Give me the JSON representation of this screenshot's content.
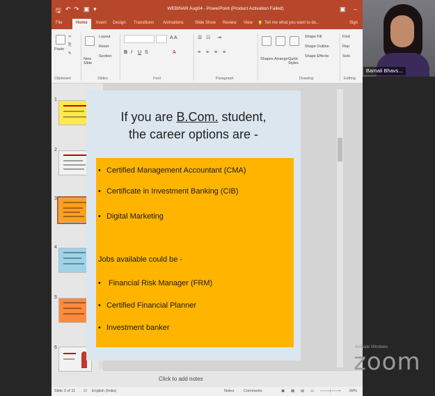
{
  "window": {
    "title": "WEBINAR Aug04 - PowerPoint (Product Activation Failed)"
  },
  "tabs": [
    "File",
    "Home",
    "Insert",
    "Design",
    "Transitions",
    "Animations",
    "Slide Show",
    "Review",
    "View"
  ],
  "tell_me": "Tell me what you want to do...",
  "sign_in": "Sign",
  "ribbon": {
    "paste": "Paste",
    "new_slide": "New Slide",
    "layout": "Layout",
    "reset": "Reset",
    "section": "Section",
    "shapes": "Shapes",
    "arrange": "Arrange",
    "quick_styles": "Quick Styles",
    "shape_fill": "Shape Fill",
    "shape_outline": "Shape Outline",
    "shape_effects": "Shape Effects",
    "find": "Find",
    "replace": "Rep",
    "select": "Sele",
    "groups": {
      "clipboard": "Clipboard",
      "slides": "Slides",
      "font": "Font",
      "paragraph": "Paragraph",
      "drawing": "Drawing",
      "editing": "Editing"
    }
  },
  "thumbnails": [
    {
      "num": "1",
      "color": "#ffe94d"
    },
    {
      "num": "2",
      "color": "#f2f2f2"
    },
    {
      "num": "3",
      "color": "#ff9f1c"
    },
    {
      "num": "4",
      "color": "#9dd3e8"
    },
    {
      "num": "5",
      "color": "#ff8a3d"
    },
    {
      "num": "6",
      "color": "#f2f2f2"
    }
  ],
  "slide": {
    "title_line1_prefix": "If you are ",
    "title_line1_underlined": "B.Com.",
    "title_line1_suffix": " student,",
    "title_line2": "the career options are -",
    "bullets": [
      "Certified Management Accountant (CMA)",
      "Certificate in Investment Banking (CIB)",
      "Digital Marketing"
    ],
    "jobs_heading": "Jobs available could be -",
    "jobs": [
      "Financial Risk Manager (FRM)",
      "Certified Financial Planner",
      "Investment banker"
    ],
    "bullet_char": "•"
  },
  "notes_placeholder": "Click to add notes",
  "status": {
    "slide_info": "Slide 3 of 11",
    "language": "English (India)",
    "notes": "Notes",
    "comments": "Comments",
    "zoom": "69%"
  },
  "video": {
    "participant_name": "Barnali Bhavs..."
  },
  "watermark": "Activate Windows",
  "zoom_logo": "zoom",
  "colors": {
    "ppt_accent": "#b7472a",
    "content_box": "#ffb400"
  }
}
